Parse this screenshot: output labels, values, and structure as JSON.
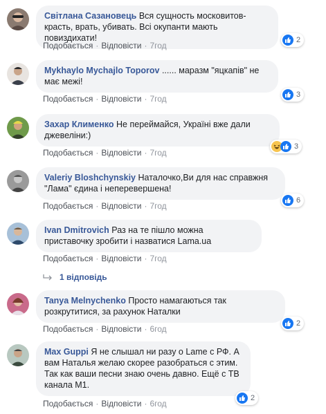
{
  "actions": {
    "like": "Подобається",
    "reply": "Відповісти"
  },
  "comments": [
    {
      "author": "Світлана Сазановець",
      "text": "Вся сущность московитов- красть, врать, убивать. Всі окупанти мають повиздихати!",
      "time": "7год",
      "reactions": {
        "types": [
          "like-icon"
        ],
        "count": "2"
      }
    },
    {
      "author": "Mykhaylo Mychajlo Toporov",
      "text": "...... маразм \"яцкапів\" не має межі!",
      "time": "7год",
      "reactions": {
        "types": [
          "like-icon"
        ],
        "count": "3"
      }
    },
    {
      "author": "Захар Клименко",
      "text": "Не переймайся, Україні вже дали джевеліни:)",
      "time": "7год",
      "reactions": {
        "types": [
          "haha-icon",
          "like-icon"
        ],
        "count": "3"
      }
    },
    {
      "author": "Valeriy Bloshchynskiy",
      "text": "Наталочко,Ви для нас справжня \"Лама\" єдина і неперевершена!",
      "time": "7год",
      "reactions": {
        "types": [
          "like-icon"
        ],
        "count": "6"
      }
    },
    {
      "author": "Ivan Dmitrovich",
      "text": "Раз на те пішло можна приставочку зробити і назватися Lama.ua",
      "time": "7год",
      "reactions": null
    },
    {
      "author": "Tanya Melnychenko",
      "text": "Просто намагаються так розкрутитися, за рахунок Наталки",
      "time": "6год",
      "reactions": {
        "types": [
          "like-icon"
        ],
        "count": "2"
      }
    },
    {
      "author": "Max Guppi",
      "text": "Я не слышал ни разу о Lame с РФ. А вам Наталья желаю скорее разобраться с этим. Так как ваши песни знаю очень давно. Ещё с ТВ канала М1.",
      "time": "6год",
      "reactions": {
        "types": [
          "like-icon"
        ],
        "count": "2"
      }
    }
  ],
  "replies_link": "1 відповідь",
  "colors": {
    "author": "#385898",
    "bubble": "#f2f3f5",
    "like": "#1877f2",
    "meta": "#90949c"
  }
}
